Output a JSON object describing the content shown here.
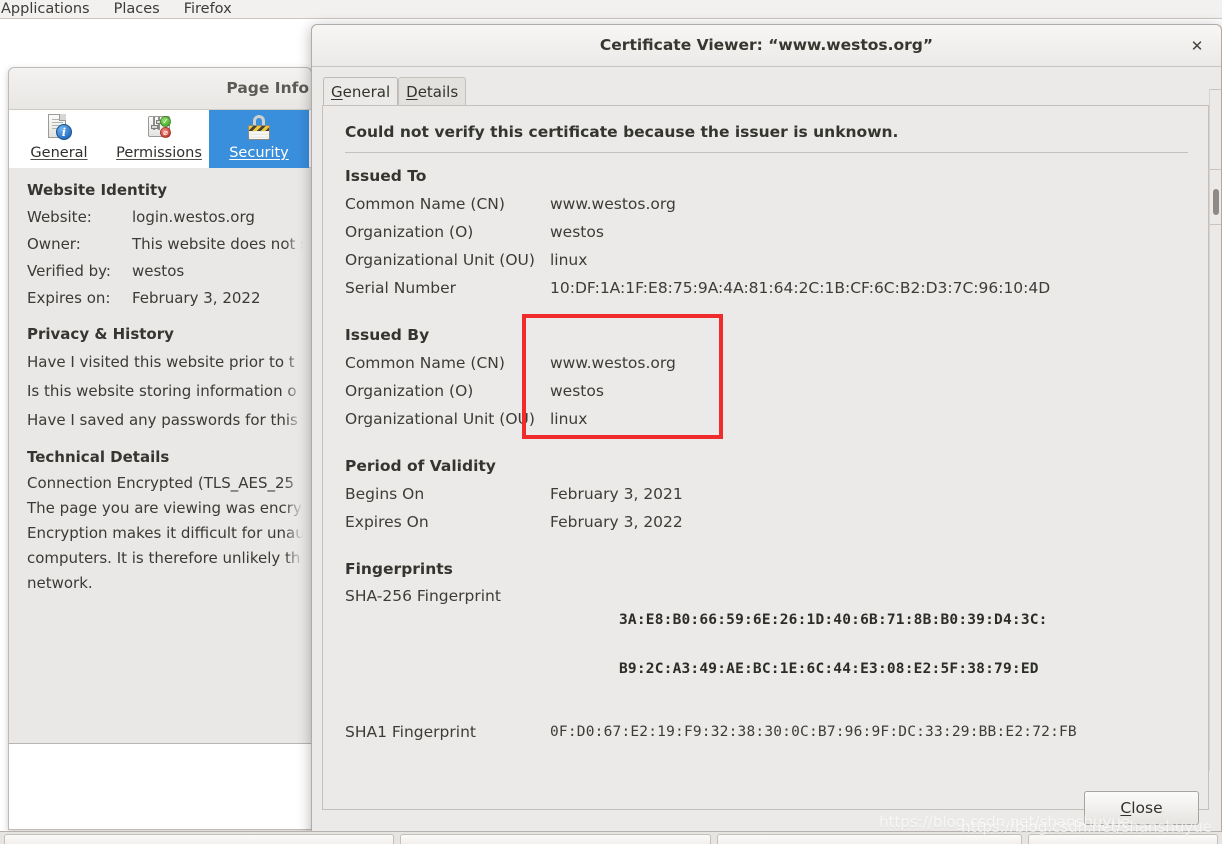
{
  "desktop": {
    "panel_items": [
      {
        "label": "Applications",
        "name": "applications-menu"
      },
      {
        "label": "Places",
        "name": "places-menu"
      },
      {
        "label": "Firefox",
        "name": "firefox-menu"
      }
    ]
  },
  "page_info": {
    "title": "Page Info",
    "toolbar": [
      {
        "label": "General",
        "icon": "document-info-icon",
        "active": false
      },
      {
        "label": "Permissions",
        "icon": "permissions-sliders-icon",
        "active": false
      },
      {
        "label": "Security",
        "icon": "padlock-icon",
        "active": true
      }
    ],
    "website_identity": {
      "heading": "Website Identity",
      "rows": [
        {
          "key": "Website:",
          "value": "login.westos.org"
        },
        {
          "key": "Owner:",
          "value": "This website does not s"
        },
        {
          "key": "Verified by:",
          "value": "westos"
        },
        {
          "key": "Expires on:",
          "value": "February 3, 2022"
        }
      ]
    },
    "privacy_history": {
      "heading": "Privacy & History",
      "lines": [
        "Have I visited this website prior to t",
        "Is this website storing information o",
        "Have I saved any passwords for this"
      ]
    },
    "technical_details": {
      "heading": "Technical Details",
      "lines": [
        "Connection Encrypted (TLS_AES_25",
        "The page you are viewing was encry",
        "Encryption makes it difficult for unau",
        "computers. It is therefore unlikely th",
        "network."
      ]
    }
  },
  "cert_dialog": {
    "title": "Certificate Viewer: “www.westos.org”",
    "close_icon": "✕",
    "tabs": [
      {
        "label": "General",
        "mnemonic": "G",
        "rest": "eneral",
        "active": true
      },
      {
        "label": "Details",
        "mnemonic": "D",
        "rest": "etails",
        "active": false
      }
    ],
    "notice": "Could not verify this certificate because the issuer is unknown.",
    "issued_to": {
      "heading": "Issued To",
      "rows": [
        {
          "key": "Common Name (CN)",
          "value": "www.westos.org"
        },
        {
          "key": "Organization (O)",
          "value": "westos"
        },
        {
          "key": "Organizational Unit (OU)",
          "value": "linux"
        },
        {
          "key": "Serial Number",
          "value": "10:DF:1A:1F:E8:75:9A:4A:81:64:2C:1B:CF:6C:B2:D3:7C:96:10:4D"
        }
      ]
    },
    "issued_by": {
      "heading": "Issued By",
      "rows": [
        {
          "key": "Common Name (CN)",
          "value": "www.westos.org"
        },
        {
          "key": "Organization (O)",
          "value": "westos"
        },
        {
          "key": "Organizational Unit (OU)",
          "value": "linux"
        }
      ]
    },
    "period_of_validity": {
      "heading": "Period of Validity",
      "rows": [
        {
          "key": "Begins On",
          "value": "February 3, 2021"
        },
        {
          "key": "Expires On",
          "value": "February 3, 2022"
        }
      ]
    },
    "fingerprints": {
      "heading": "Fingerprints",
      "sha256": {
        "key": "SHA-256 Fingerprint",
        "line1": "3A:E8:B0:66:59:6E:26:1D:40:6B:71:8B:B0:39:D4:3C:",
        "line2": "B9:2C:A3:49:AE:BC:1E:6C:44:E3:08:E2:5F:38:79:ED"
      },
      "sha1": {
        "key": "SHA1 Fingerprint",
        "value": "0F:D0:67:E2:19:F9:32:38:30:0C:B7:96:9F:DC:33:29:BB:E2:72:FB"
      }
    },
    "close_button": {
      "mnemonic": "C",
      "rest": "lose"
    },
    "highlight_color": "#f02b2b"
  },
  "watermark": {
    "text": "https://blog.csdn.net/shanshuyue"
  }
}
